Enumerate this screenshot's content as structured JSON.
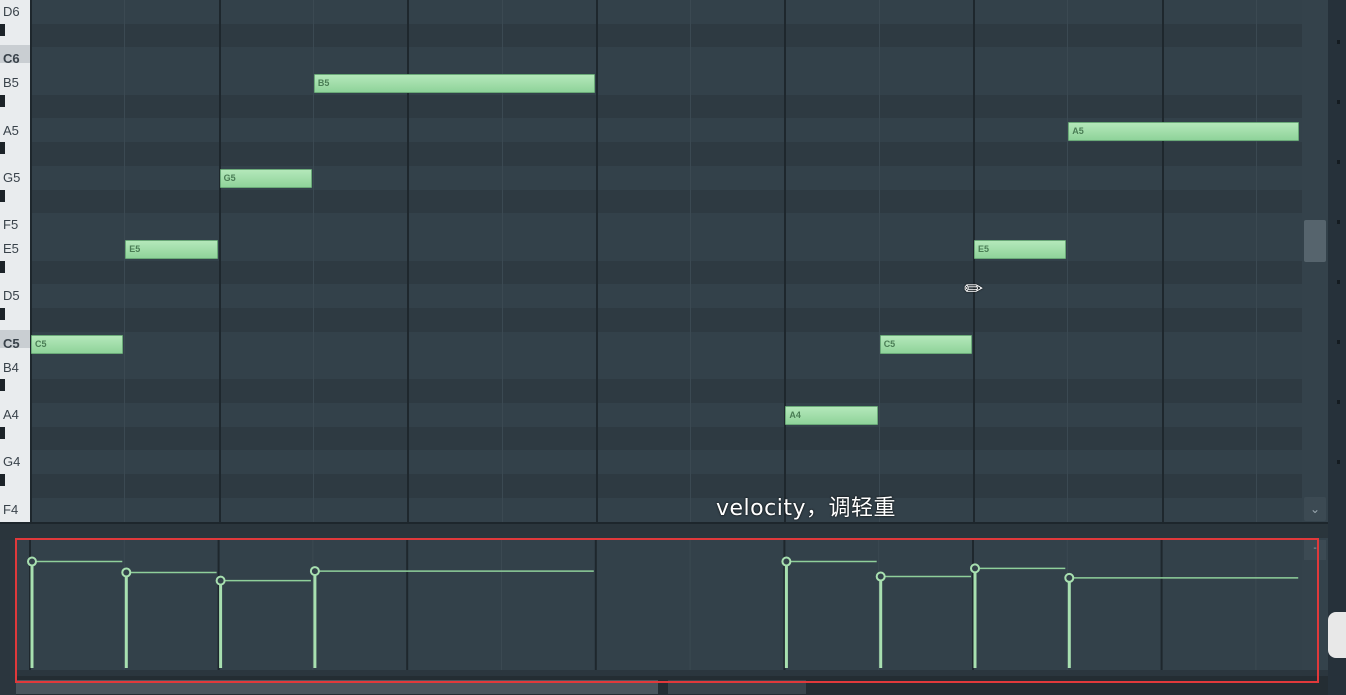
{
  "piano_roll": {
    "key_labels": [
      "D6",
      "C6",
      "B5",
      "A5",
      "G5",
      "F5",
      "E5",
      "D5",
      "C5",
      "B4",
      "A4",
      "G4",
      "F4"
    ],
    "notes": [
      {
        "label": "C5",
        "pitch": "C5"
      },
      {
        "label": "E5",
        "pitch": "E5"
      },
      {
        "label": "G5",
        "pitch": "G5"
      },
      {
        "label": "B5",
        "pitch": "B5"
      },
      {
        "label": "A4",
        "pitch": "A4"
      },
      {
        "label": "C5",
        "pitch": "C5"
      },
      {
        "label": "E5",
        "pitch": "E5"
      },
      {
        "label": "A5",
        "pitch": "A5"
      }
    ],
    "note_color": "#9fdcaa",
    "grid_color": "#33414a"
  },
  "velocity": {
    "values": [
      0.78,
      0.7,
      0.64,
      0.71,
      0.78,
      0.67,
      0.73,
      0.66
    ],
    "highlight_color": "#e0393b"
  },
  "caption": {
    "text": "velocity，调轻重"
  },
  "icons": {
    "cursor": "pencil-cursor-icon",
    "scroll_down": "chevron-down-icon"
  }
}
